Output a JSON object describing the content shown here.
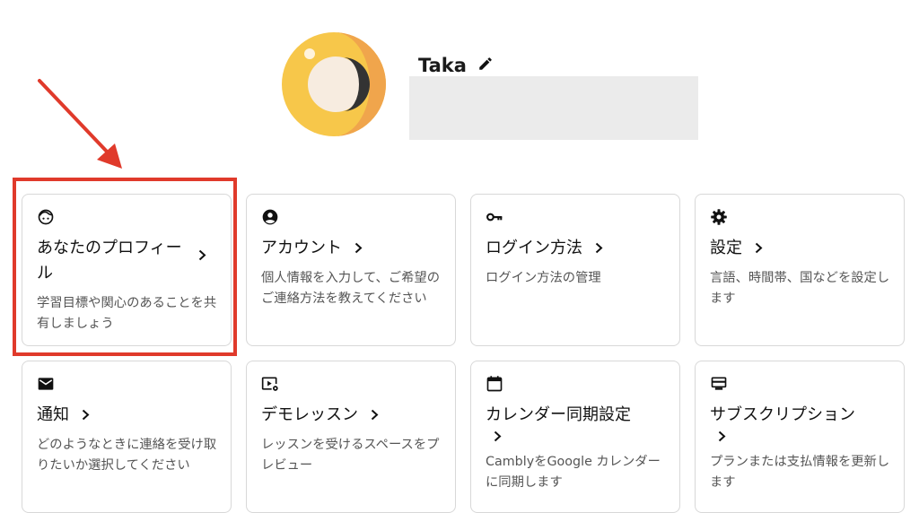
{
  "profile": {
    "name": "Taka"
  },
  "cards": [
    {
      "icon": "smiley-face-icon",
      "title": "あなたのプロフィール",
      "title_line1": "あなたのプロフィー",
      "title_line2": "ル",
      "description": "学習目標や関心のあることを共有しましょう"
    },
    {
      "icon": "account-circle-icon",
      "title": "アカウント",
      "description": "個人情報を入力して、ご希望のご連絡方法を教えてください"
    },
    {
      "icon": "key-icon",
      "title": "ログイン方法",
      "description": "ログイン方法の管理"
    },
    {
      "icon": "gear-icon",
      "title": "設定",
      "description": "言語、時間帯、国などを設定します"
    },
    {
      "icon": "mail-icon",
      "title": "通知",
      "description": "どのようなときに連絡を受け取りたいか選択してください"
    },
    {
      "icon": "video-settings-icon",
      "title": "デモレッスン",
      "description": "レッスンを受けるスペースをプレビュー"
    },
    {
      "icon": "calendar-icon",
      "title": "カレンダー同期設定",
      "description": "CamblyをGoogle カレンダーに同期します"
    },
    {
      "icon": "card-icon",
      "title": "サブスクリプション",
      "description": "プランまたは支払情報を更新します"
    }
  ],
  "colors": {
    "highlight": "#e03a2b",
    "arrow": "#e03a2b",
    "avatar_yellow": "#f7c74a",
    "avatar_orange": "#f0a54c"
  }
}
